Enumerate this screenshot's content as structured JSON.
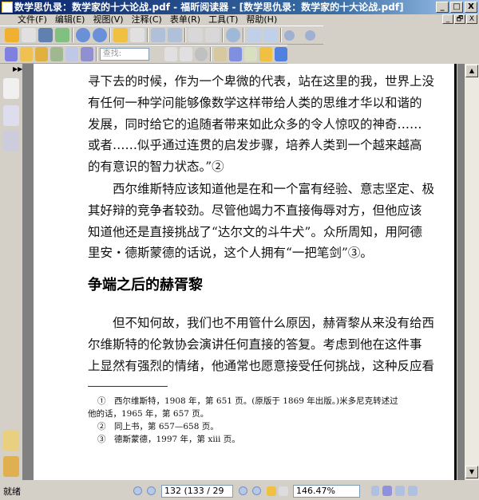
{
  "window": {
    "title": "数学思仇录：数学家的十大论战.pdf - 福昕阅读器 - [数学思仇录：数学家的十大论战.pdf]",
    "min": "_",
    "max": "□",
    "close": "X",
    "restore": "🗗"
  },
  "menu": [
    "文件(F)",
    "编辑(E)",
    "视图(V)",
    "注释(C)",
    "表单(R)",
    "工具(T)",
    "帮助(H)"
  ],
  "find": {
    "placeholder": "查找:"
  },
  "document": {
    "para1": [
      "寻下去的时候，作为一个卑微的代表，站在这里的我，世界上没",
      "有任何一种学问能够像数学这样带给人类的思维才华以和谐的",
      "发展，同时给它的追随者带来如此众多的令人惊叹的神奇……",
      "或者……似乎通过连贯的启发步骤，培养人类到一个越来越高",
      "的有意识的智力状态。”②"
    ],
    "para2": [
      "西尔维斯特应该知道他是在和一个富有经验、意志坚定、极",
      "其好辩的竞争者较劲。尽管他竭力不直接侮辱对方，但他应该",
      "知道他还是直接挑战了“达尔文的斗牛犬”。众所周知，用阿德",
      "里安・德斯蒙德的话说，这个人拥有“一把笔剑”③。"
    ],
    "heading": "争端之后的赫胥黎",
    "para3": [
      "但不知何故，我们也不用管什么原因，赫胥黎从来没有给西",
      "尔维斯特的伦敦协会演讲任何直接的答复。考虑到他在这件事",
      "上显然有强烈的情绪，他通常也愿意接受任何挑战，这种反应看"
    ],
    "footnotes": [
      "①　西尔维斯特，1908 年，第 651 页。(原版于 1869 年出版。)米多尼克转述过",
      "他的话，1965 年，第 657 页。",
      "②　同上书，第 657—658 页。",
      "③　德斯蒙德，1997 年，第 xiii 页。"
    ]
  },
  "status": {
    "text": "就绪",
    "page": "132 (133 / 29",
    "zoom": "146.47%"
  }
}
